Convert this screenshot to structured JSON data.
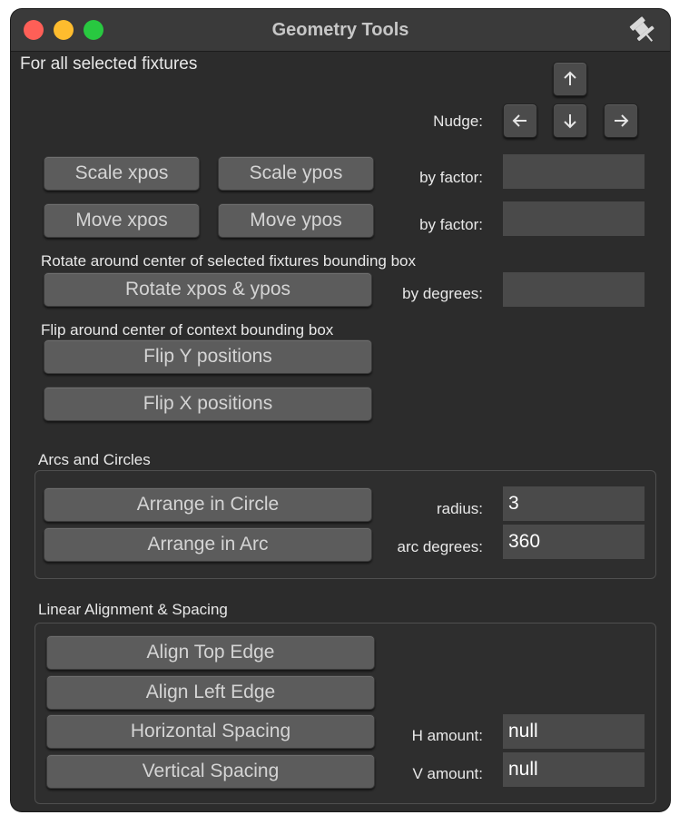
{
  "window": {
    "title": "Geometry Tools"
  },
  "header": {
    "scope_label": "For all selected fixtures"
  },
  "nudge": {
    "label": "Nudge:",
    "up_icon": "arrow-up-icon",
    "left_icon": "arrow-left-icon",
    "down_icon": "arrow-down-icon",
    "right_icon": "arrow-right-icon"
  },
  "scale": {
    "scale_x_label": "Scale xpos",
    "scale_y_label": "Scale ypos",
    "factor_label": "by factor:",
    "factor_value": ""
  },
  "move": {
    "move_x_label": "Move xpos",
    "move_y_label": "Move ypos",
    "factor_label": "by factor:",
    "factor_value": ""
  },
  "rotate": {
    "section_label": "Rotate around center of selected fixtures bounding box",
    "button_label": "Rotate xpos & ypos",
    "degrees_label": "by degrees:",
    "degrees_value": ""
  },
  "flip": {
    "section_label": "Flip around center of context bounding box",
    "flip_y_label": "Flip Y positions",
    "flip_x_label": "Flip X positions"
  },
  "arcs": {
    "section_label": "Arcs and Circles",
    "circle_label": "Arrange in Circle",
    "arc_label": "Arrange in Arc",
    "radius_label": "radius:",
    "radius_value": "3",
    "arc_degrees_label": "arc degrees:",
    "arc_degrees_value": "360"
  },
  "linear": {
    "section_label": "Linear Alignment & Spacing",
    "align_top_label": "Align Top Edge",
    "align_left_label": "Align Left Edge",
    "h_spacing_label": "Horizontal Spacing",
    "v_spacing_label": "Vertical Spacing",
    "h_amount_label": "H amount:",
    "h_amount_value": "null",
    "v_amount_label": "V amount:",
    "v_amount_value": "null"
  }
}
